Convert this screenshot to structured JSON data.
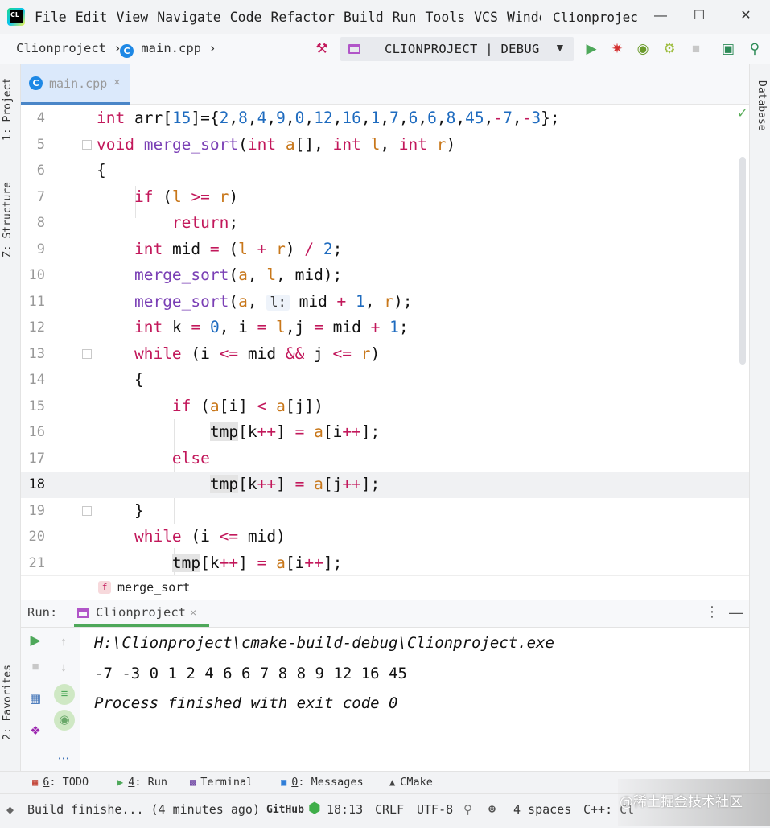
{
  "menubar": {
    "items": [
      "File",
      "Edit",
      "View",
      "Navigate",
      "Code",
      "Refactor",
      "Build",
      "Run",
      "Tools",
      "VCS",
      "Windo"
    ],
    "project_title": "Clionprojec"
  },
  "navbar": {
    "project": "Clionproject",
    "file": "main.cpp",
    "run_config": "CLIONPROJECT | DEBUG"
  },
  "left_tabs": {
    "project": "1: Project",
    "structure": "Z: Structure",
    "favorites": "2: Favorites"
  },
  "right_tabs": {
    "database": "Database"
  },
  "editor": {
    "tab": {
      "filename": "main.cpp"
    },
    "current_line": "18",
    "breadcrumb_function": "merge_sort",
    "line_numbers": [
      "4",
      "5",
      "6",
      "7",
      "8",
      "9",
      "10",
      "11",
      "12",
      "13",
      "14",
      "15",
      "16",
      "17",
      "18",
      "19",
      "20",
      "21"
    ],
    "lines": [
      "int arr[15]={2,8,4,9,0,12,16,1,7,6,6,8,45,-7,-3};",
      "void merge_sort(int a[], int l, int r)",
      "{",
      "    if (l >= r)",
      "        return;",
      "    int mid = (l + r) / 2;",
      "    merge_sort(a, l, mid);",
      "    merge_sort(a, l: mid + 1, r);",
      "    int k = 0, i = l,j = mid + 1;",
      "    while (i <= mid && j <= r)",
      "    {",
      "        if (a[i] < a[j])",
      "            tmp[k++] = a[i++];",
      "        else",
      "            tmp[k++] = a[j++];",
      "    }",
      "    while (i <= mid)",
      "        tmp[k++] = a[i++];"
    ],
    "inlay_hint": "l:"
  },
  "run_panel": {
    "label": "Run:",
    "tab_name": "Clionproject",
    "output": [
      "H:\\Clionproject\\cmake-build-debug\\Clionproject.exe",
      "-7 -3 0 1 2 4 6 6 7 8 8 9 12 16 45",
      "Process finished with exit code 0"
    ]
  },
  "tool_windows": [
    {
      "num": "6",
      "rest": ": TODO"
    },
    {
      "num": "4",
      "rest": ": Run"
    },
    {
      "num": "",
      "rest": "Terminal"
    },
    {
      "num": "0",
      "rest": ": Messages"
    },
    {
      "num": "",
      "rest": "CMake"
    }
  ],
  "statusbar": {
    "message": "Build finishe... (4 minutes ago)",
    "github": "GitHub",
    "position": "18:13",
    "line_sep": "CRLF",
    "encoding": "UTF-8",
    "indent": "4 spaces",
    "lang": "C++: Cl"
  },
  "watermark": "@稀土掘金技术社区",
  "colors": {
    "keyword": "#c2185b",
    "number": "#1e6bbf",
    "function": "#7a3fb5",
    "param": "#c8771a",
    "run_green": "#4ea85a"
  }
}
